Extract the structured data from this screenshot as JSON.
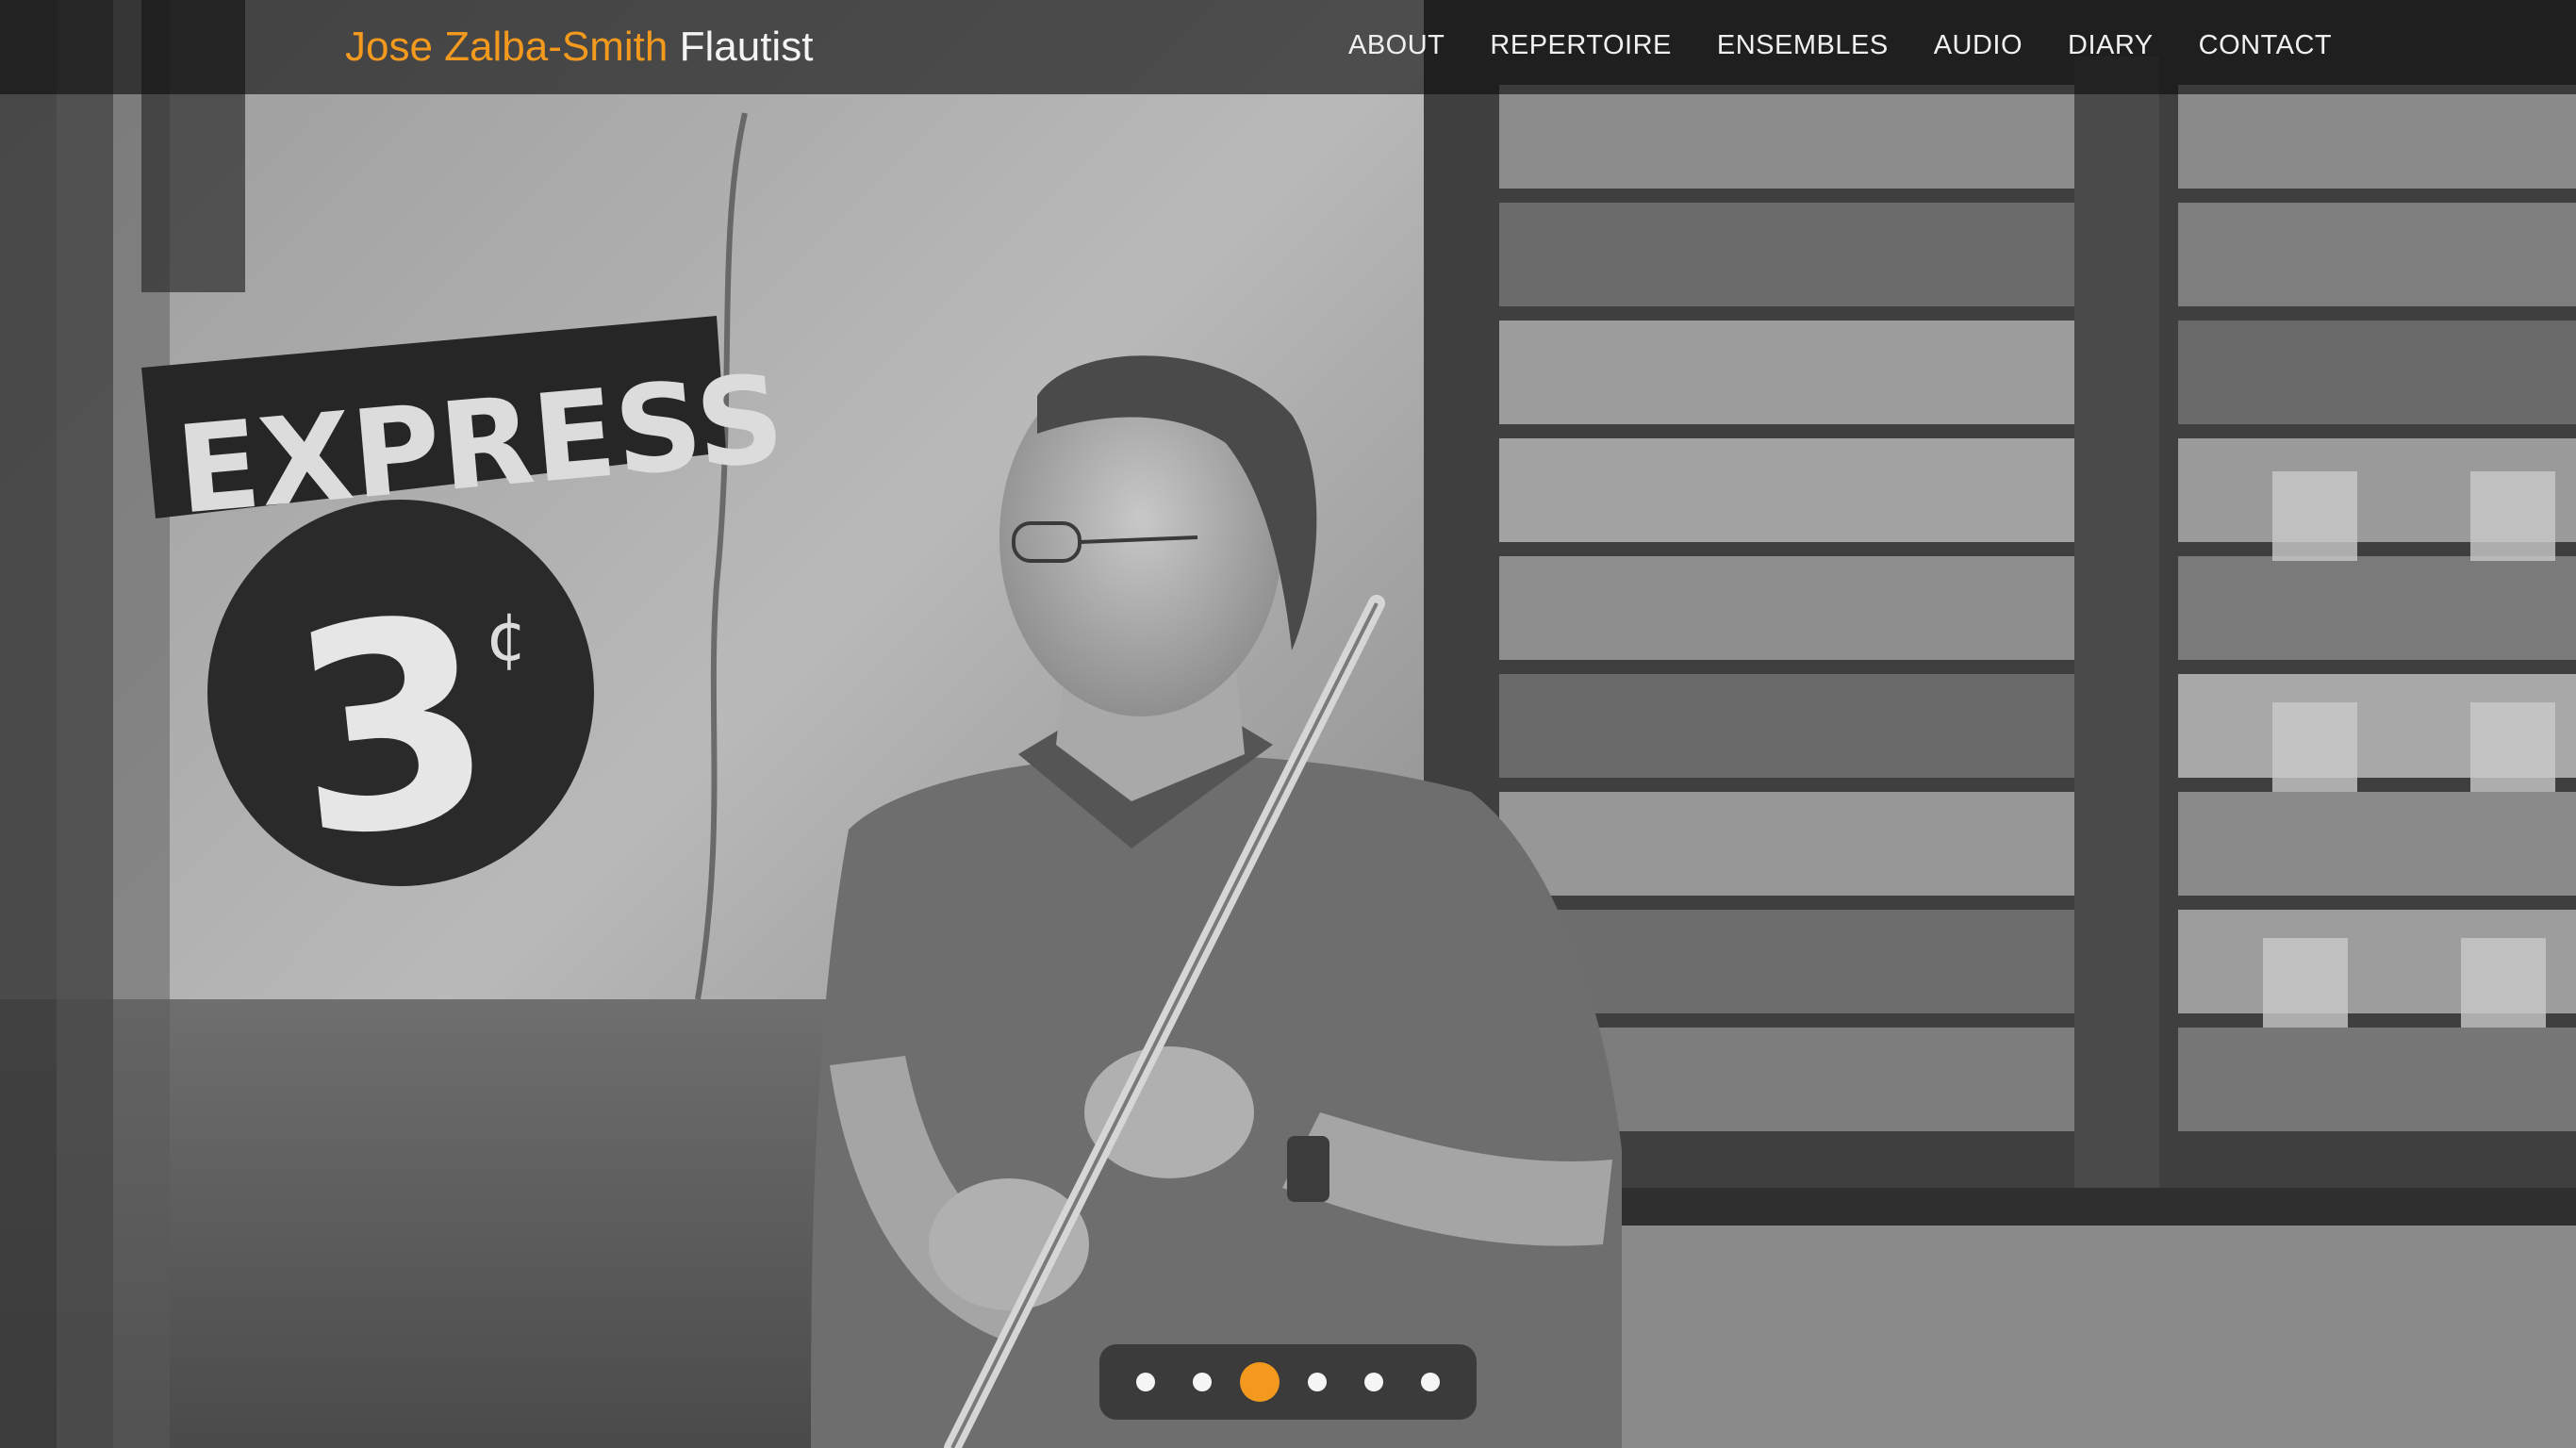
{
  "header": {
    "brand_name": "Jose Zalba-Smith",
    "brand_role": "Flautist",
    "brand_color": "#f39a1e"
  },
  "nav": {
    "items": [
      {
        "label": "ABOUT"
      },
      {
        "label": "REPERTOIRE"
      },
      {
        "label": "ENSEMBLES"
      },
      {
        "label": "AUDIO"
      },
      {
        "label": "DIARY"
      },
      {
        "label": "CONTACT"
      }
    ]
  },
  "slider": {
    "slide_count": 6,
    "active_slide": 3,
    "image_description_icon": "hero-photo",
    "wall_sign_text": "EXPRESS",
    "wall_sign_number": "3",
    "wall_sign_unit": "¢"
  }
}
